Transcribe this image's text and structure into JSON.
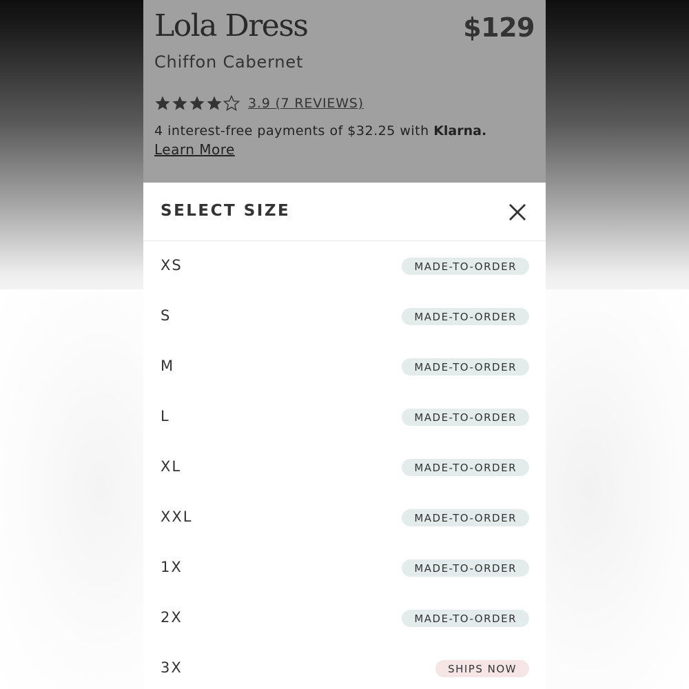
{
  "product": {
    "title": "Lola Dress",
    "price": "$129",
    "variant": "Chiffon Cabernet",
    "rating": 3.9,
    "reviews_text": "3.9 (7 REVIEWS)",
    "payments_text": "4 interest-free payments of $32.25 with ",
    "payments_brand": "Klarna.",
    "learn_more": "Learn More"
  },
  "size_sheet": {
    "title": "SELECT SIZE",
    "close_icon": "close-icon",
    "sizes": [
      {
        "label": "XS",
        "status": "MADE-TO-ORDER",
        "status_color": "#e3ebeb"
      },
      {
        "label": "S",
        "status": "MADE-TO-ORDER",
        "status_color": "#e3ebeb"
      },
      {
        "label": "M",
        "status": "MADE-TO-ORDER",
        "status_color": "#e3ebeb"
      },
      {
        "label": "L",
        "status": "MADE-TO-ORDER",
        "status_color": "#e3ebeb"
      },
      {
        "label": "XL",
        "status": "MADE-TO-ORDER",
        "status_color": "#e3ebeb"
      },
      {
        "label": "XXL",
        "status": "MADE-TO-ORDER",
        "status_color": "#e3ebeb"
      },
      {
        "label": "1X",
        "status": "MADE-TO-ORDER",
        "status_color": "#e3ebeb"
      },
      {
        "label": "2X",
        "status": "MADE-TO-ORDER",
        "status_color": "#e3ebeb"
      },
      {
        "label": "3X",
        "status": "SHIPS NOW",
        "status_color": "#f6e5e5"
      }
    ]
  }
}
